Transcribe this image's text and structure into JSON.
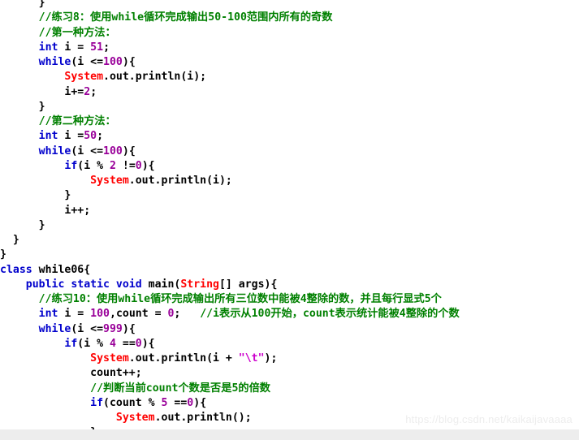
{
  "editor": {
    "language": "Java",
    "colors": {
      "background": "#ffffff",
      "keyword": "#0000cc",
      "class_name": "#ff0000",
      "number": "#990099",
      "string": "#cc00cc",
      "comment": "#008000",
      "plain_text": "#000000",
      "watermark": "#ededed",
      "bottom_strip": "#ededed"
    }
  },
  "watermark": {
    "text": "https://blog.csdn.net/kaikaijavaaaa"
  },
  "code": {
    "lines": [
      {
        "indent": 3,
        "tokens": [
          {
            "t": "plain",
            "s": "}"
          }
        ]
      },
      {
        "indent": 3,
        "tokens": [
          {
            "t": "cmt",
            "s": "//练习8：使用while循环完成输出50-100范围内所有的奇数"
          }
        ]
      },
      {
        "indent": 3,
        "tokens": [
          {
            "t": "cmt",
            "s": "//第一种方法："
          }
        ]
      },
      {
        "indent": 3,
        "tokens": [
          {
            "t": "kw",
            "s": "int"
          },
          {
            "t": "plain",
            "s": " i = "
          },
          {
            "t": "num",
            "s": "51"
          },
          {
            "t": "plain",
            "s": ";"
          }
        ]
      },
      {
        "indent": 3,
        "tokens": [
          {
            "t": "kw",
            "s": "while"
          },
          {
            "t": "plain",
            "s": "(i <="
          },
          {
            "t": "num",
            "s": "100"
          },
          {
            "t": "plain",
            "s": "){"
          }
        ]
      },
      {
        "indent": 5,
        "tokens": [
          {
            "t": "cls",
            "s": "System"
          },
          {
            "t": "plain",
            "s": ".out.println(i);"
          }
        ]
      },
      {
        "indent": 5,
        "tokens": [
          {
            "t": "plain",
            "s": "i+="
          },
          {
            "t": "num",
            "s": "2"
          },
          {
            "t": "plain",
            "s": ";"
          }
        ]
      },
      {
        "indent": 3,
        "tokens": [
          {
            "t": "plain",
            "s": "}"
          }
        ]
      },
      {
        "indent": 3,
        "tokens": [
          {
            "t": "cmt",
            "s": "//第二种方法："
          }
        ]
      },
      {
        "indent": 3,
        "tokens": [
          {
            "t": "kw",
            "s": "int"
          },
          {
            "t": "plain",
            "s": " i ="
          },
          {
            "t": "num",
            "s": "50"
          },
          {
            "t": "plain",
            "s": ";"
          }
        ]
      },
      {
        "indent": 3,
        "tokens": [
          {
            "t": "kw",
            "s": "while"
          },
          {
            "t": "plain",
            "s": "(i <="
          },
          {
            "t": "num",
            "s": "100"
          },
          {
            "t": "plain",
            "s": "){"
          }
        ]
      },
      {
        "indent": 5,
        "tokens": [
          {
            "t": "kw",
            "s": "if"
          },
          {
            "t": "plain",
            "s": "(i % "
          },
          {
            "t": "num",
            "s": "2"
          },
          {
            "t": "plain",
            "s": " !="
          },
          {
            "t": "num",
            "s": "0"
          },
          {
            "t": "plain",
            "s": "){"
          }
        ]
      },
      {
        "indent": 7,
        "tokens": [
          {
            "t": "cls",
            "s": "System"
          },
          {
            "t": "plain",
            "s": ".out.println(i);"
          }
        ]
      },
      {
        "indent": 5,
        "tokens": [
          {
            "t": "plain",
            "s": "}"
          }
        ]
      },
      {
        "indent": 5,
        "tokens": [
          {
            "t": "plain",
            "s": "i++;"
          }
        ]
      },
      {
        "indent": 3,
        "tokens": [
          {
            "t": "plain",
            "s": "}"
          }
        ]
      },
      {
        "indent": 1,
        "tokens": [
          {
            "t": "plain",
            "s": "}"
          }
        ]
      },
      {
        "indent": 0,
        "tokens": [
          {
            "t": "plain",
            "s": "}"
          }
        ]
      },
      {
        "indent": 0,
        "tokens": [
          {
            "t": "kw",
            "s": "class"
          },
          {
            "t": "plain",
            "s": " while06{"
          }
        ]
      },
      {
        "indent": 2,
        "tokens": [
          {
            "t": "kw",
            "s": "public static void"
          },
          {
            "t": "plain",
            "s": " main("
          },
          {
            "t": "cls",
            "s": "String"
          },
          {
            "t": "plain",
            "s": "[] args){"
          }
        ]
      },
      {
        "indent": 3,
        "tokens": [
          {
            "t": "cmt",
            "s": "//练习10：使用while循环完成输出所有三位数中能被4整除的数，并且每行显式5个"
          }
        ]
      },
      {
        "indent": 3,
        "tokens": [
          {
            "t": "kw",
            "s": "int"
          },
          {
            "t": "plain",
            "s": " i = "
          },
          {
            "t": "num",
            "s": "100"
          },
          {
            "t": "plain",
            "s": ",count = "
          },
          {
            "t": "num",
            "s": "0"
          },
          {
            "t": "plain",
            "s": ";   "
          },
          {
            "t": "cmt",
            "s": "//i表示从100开始，count表示统计能被4整除的个数"
          }
        ]
      },
      {
        "indent": 3,
        "tokens": [
          {
            "t": "kw",
            "s": "while"
          },
          {
            "t": "plain",
            "s": "(i <="
          },
          {
            "t": "num",
            "s": "999"
          },
          {
            "t": "plain",
            "s": "){"
          }
        ]
      },
      {
        "indent": 5,
        "tokens": [
          {
            "t": "kw",
            "s": "if"
          },
          {
            "t": "plain",
            "s": "(i % "
          },
          {
            "t": "num",
            "s": "4"
          },
          {
            "t": "plain",
            "s": " =="
          },
          {
            "t": "num",
            "s": "0"
          },
          {
            "t": "plain",
            "s": "){"
          }
        ]
      },
      {
        "indent": 7,
        "tokens": [
          {
            "t": "cls",
            "s": "System"
          },
          {
            "t": "plain",
            "s": ".out.println(i + "
          },
          {
            "t": "str",
            "s": "\"\\t\""
          },
          {
            "t": "plain",
            "s": ");"
          }
        ]
      },
      {
        "indent": 7,
        "tokens": [
          {
            "t": "plain",
            "s": "count++;"
          }
        ]
      },
      {
        "indent": 7,
        "tokens": [
          {
            "t": "cmt",
            "s": "//判断当前count个数是否是5的倍数"
          }
        ]
      },
      {
        "indent": 7,
        "tokens": [
          {
            "t": "kw",
            "s": "if"
          },
          {
            "t": "plain",
            "s": "(count % "
          },
          {
            "t": "num",
            "s": "5"
          },
          {
            "t": "plain",
            "s": " =="
          },
          {
            "t": "num",
            "s": "0"
          },
          {
            "t": "plain",
            "s": "){"
          }
        ]
      },
      {
        "indent": 9,
        "tokens": [
          {
            "t": "cls",
            "s": "System"
          },
          {
            "t": "plain",
            "s": ".out.println();"
          }
        ]
      },
      {
        "indent": 7,
        "tokens": [
          {
            "t": "plain",
            "s": "}"
          }
        ]
      }
    ]
  }
}
